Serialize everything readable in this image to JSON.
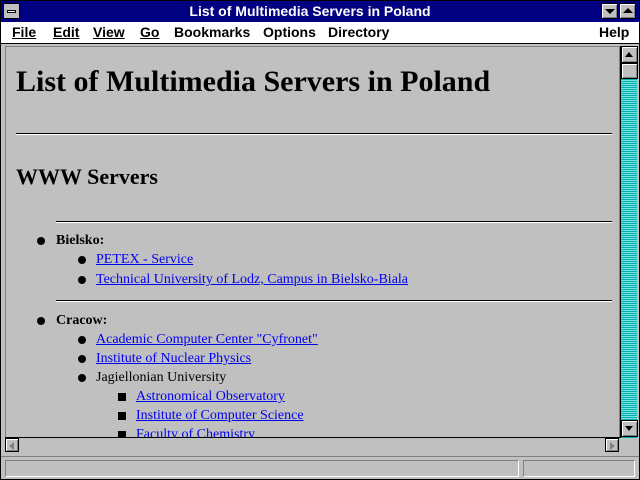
{
  "window": {
    "title": "List of Multimedia Servers in Poland"
  },
  "menubar": {
    "items": [
      "File",
      "Edit",
      "View",
      "Go",
      "Bookmarks",
      "Options",
      "Directory",
      "Help"
    ]
  },
  "page": {
    "heading": "List of Multimedia Servers in Poland",
    "section_heading": "WWW Servers",
    "cities": [
      {
        "name": "Bielsko:",
        "entries": [
          "PETEX - Service ",
          "Technical University of Lodz, Campus in Bielsko-Biala"
        ]
      },
      {
        "name": "Cracow:",
        "entries": [
          "Academic Computer Center \"Cyfronet\" ",
          "Institute of Nuclear Physics ",
          "Jagiellonian University"
        ],
        "subentries": [
          "Astronomical Observatory ",
          "Institute of Computer Science ",
          "Faculty of Chemistry"
        ]
      }
    ]
  },
  "icons": {
    "system_menu": "system-menu-icon",
    "minimize": "minimize-icon",
    "maximize": "maximize-icon",
    "scroll_up": "arrow-up-icon",
    "scroll_down": "arrow-down-icon",
    "scroll_left": "arrow-left-icon",
    "scroll_right": "arrow-right-icon"
  },
  "colors": {
    "titlebar": "#000080",
    "link": "#0000ee",
    "background": "#c0c0c0",
    "scroll_track": "#00c0c0"
  }
}
